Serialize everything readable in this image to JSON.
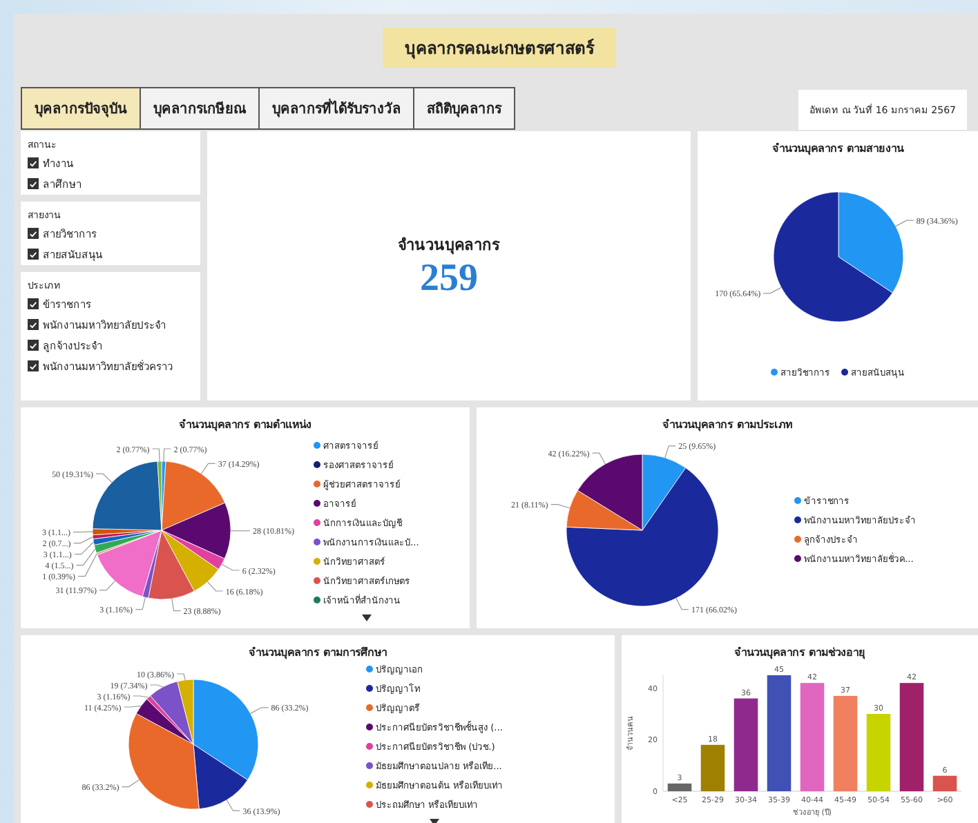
{
  "header": {
    "title": "บุคลากรคณะเกษตรศาสตร์"
  },
  "tabs": [
    {
      "label": "บุคลากรปัจจุบัน",
      "selected": true
    },
    {
      "label": "บุคลากรเกษียณ",
      "selected": false
    },
    {
      "label": "บุคลากรที่ได้รับรางวัล",
      "selected": false
    },
    {
      "label": "สถิติบุคลากร",
      "selected": false
    }
  ],
  "updated": "อัพเดท ณ วันที่ 16 มกราคม 2567",
  "filters": [
    {
      "title": "สถานะ",
      "items": [
        {
          "label": "ทำงาน",
          "checked": true
        },
        {
          "label": "ลาศึกษา",
          "checked": true
        }
      ]
    },
    {
      "title": "สายงาน",
      "items": [
        {
          "label": "สายวิชาการ",
          "checked": true
        },
        {
          "label": "สายสนับสนุน",
          "checked": true
        }
      ]
    },
    {
      "title": "ประเภท",
      "items": [
        {
          "label": "ข้าราชการ",
          "checked": true
        },
        {
          "label": "พนักงานมหาวิทยาลัยประจำ",
          "checked": true
        },
        {
          "label": "ลูกจ้างประจำ",
          "checked": true
        },
        {
          "label": "พนักงานมหาวิทยาลัยชั่วคราว",
          "checked": true
        }
      ]
    }
  ],
  "kpi": {
    "label": "จำนวนบุคลากร",
    "value": "259"
  },
  "charts": [
    {
      "title": "จำนวนบุคลากร ตามสายงาน",
      "legend": [
        {
          "label": "สายวิชาการ",
          "color": "#2196f3"
        },
        {
          "label": "สายสนับสนุน",
          "color": "#1a2a9c"
        }
      ],
      "chart_data": {
        "type": "pie",
        "values": [
          89,
          170
        ],
        "value_labels": [
          "89 (34.36%)",
          "170 (65.64%)"
        ],
        "colors": [
          "#2196f3",
          "#1a2a9c"
        ]
      }
    },
    {
      "title": "จำนวนบุคลากร ตามตำแหน่ง",
      "legend_more": true,
      "legend": [
        {
          "label": "ศาสตราจารย์",
          "color": "#2196f3"
        },
        {
          "label": "รองศาสตราจารย์",
          "color": "#10206e"
        },
        {
          "label": "ผู้ช่วยศาสตราจารย์",
          "color": "#e8692a"
        },
        {
          "label": "อาจารย์",
          "color": "#5a0a6e"
        },
        {
          "label": "นักการเงินและบัญชี",
          "color": "#e040a0"
        },
        {
          "label": "พนักงานการเงินและบั...",
          "color": "#7b52c8"
        },
        {
          "label": "นักวิทยาศาสตร์",
          "color": "#d4b000"
        },
        {
          "label": "นักวิทยาศาสตร์เกษตร",
          "color": "#d9534f"
        },
        {
          "label": "เจ้าหน้าที่สำนักงาน",
          "color": "#1e7a5a"
        }
      ],
      "chart_data": {
        "type": "pie",
        "values": [
          2,
          37,
          28,
          6,
          16,
          23,
          3,
          31,
          1,
          4,
          3,
          2,
          3,
          50,
          2
        ],
        "value_labels": [
          "2 (0.77%)",
          "37 (14.29%)",
          "28 (10.81%)",
          "6 (2.32%)",
          "16 (6.18%)",
          "23 (8.88%)",
          "3 (1.16%)",
          "31 (11.97%)",
          "1 (0.39%)",
          "4 (1.5...)",
          "3 (1.1...)",
          "2 (0.7...)",
          "3 (1.1...)",
          "50 (19.31%)",
          "2 (0.77%)"
        ],
        "colors": [
          "#2196f3",
          "#e8692a",
          "#5a0a6e",
          "#e040a0",
          "#d4b000",
          "#d9534f",
          "#7b52c8",
          "#f06ec8",
          "#e89b6c",
          "#2eaa5a",
          "#1565c0",
          "#c2185b",
          "#d35400",
          "#1a5fa0",
          "#7cb342"
        ]
      }
    },
    {
      "title": "จำนวนบุคลากร ตามประเภท",
      "legend": [
        {
          "label": "ข้าราชการ",
          "color": "#2196f3"
        },
        {
          "label": "พนักงานมหาวิทยาลัยประจำ",
          "color": "#1a2a9c"
        },
        {
          "label": "ลูกจ้างประจำ",
          "color": "#e8692a"
        },
        {
          "label": "พนักงานมหาวิทยาลัยชั่วค...",
          "color": "#5a0a6e"
        }
      ],
      "chart_data": {
        "type": "pie",
        "values": [
          25,
          171,
          21,
          42
        ],
        "value_labels": [
          "25 (9.65%)",
          "171 (66.02%)",
          "21 (8.11%)",
          "42 (16.22%)"
        ],
        "colors": [
          "#2196f3",
          "#1a2a9c",
          "#e8692a",
          "#5a0a6e"
        ]
      }
    },
    {
      "title": "จำนวนบุคลากร ตามการศึกษา",
      "legend_more": true,
      "legend": [
        {
          "label": "ปริญญาเอก",
          "color": "#2196f3"
        },
        {
          "label": "ปริญญาโท",
          "color": "#1a2a9c"
        },
        {
          "label": "ปริญญาตรี",
          "color": "#e8692a"
        },
        {
          "label": "ประกาศนียบัตรวิชาชีพชั้นสูง (...",
          "color": "#5a0a6e"
        },
        {
          "label": "ประกาศนียบัตรวิชาชีพ (ปวช.)",
          "color": "#e040a0"
        },
        {
          "label": "มัธยมศึกษาตอนปลาย หรือเทีย...",
          "color": "#7b52c8"
        },
        {
          "label": "มัธยมศึกษาตอนต้น หรือเทียบเท่า",
          "color": "#d4b000"
        },
        {
          "label": "ประถมศึกษา หรือเทียบเท่า",
          "color": "#d9534f"
        }
      ],
      "chart_data": {
        "type": "pie",
        "values": [
          86,
          36,
          86,
          11,
          3,
          19,
          10
        ],
        "value_labels": [
          "86 (33.2%)",
          "36 (13.9%)",
          "86 (33.2%)",
          "11 (4.25%)",
          "3 (1.16%)",
          "19 (7.34%)",
          "10 (3.86%)"
        ],
        "colors": [
          "#2196f3",
          "#1a2a9c",
          "#e8692a",
          "#5a0a6e",
          "#e040a0",
          "#7b52c8",
          "#d4b000"
        ]
      }
    },
    {
      "title": "จำนวนบุคลากร ตามช่วงอายุ",
      "chart_data": {
        "type": "bar",
        "categories": [
          "<25",
          "25-29",
          "30-34",
          "35-39",
          "40-44",
          "45-49",
          "50-54",
          "55-60",
          ">60"
        ],
        "values": [
          3,
          18,
          36,
          45,
          42,
          37,
          30,
          42,
          6
        ],
        "colors": [
          "#666666",
          "#a08000",
          "#8e2a8e",
          "#3f51b5",
          "#e066c0",
          "#f08060",
          "#c8d400",
          "#a0206a",
          "#d9534f"
        ],
        "xlabel": "ช่วงอายุ (ปี)",
        "ylabel": "จำนวนคน",
        "ylim": [
          0,
          45
        ],
        "yticks": [
          0,
          20,
          40
        ],
        "data_labels": true
      }
    }
  ]
}
